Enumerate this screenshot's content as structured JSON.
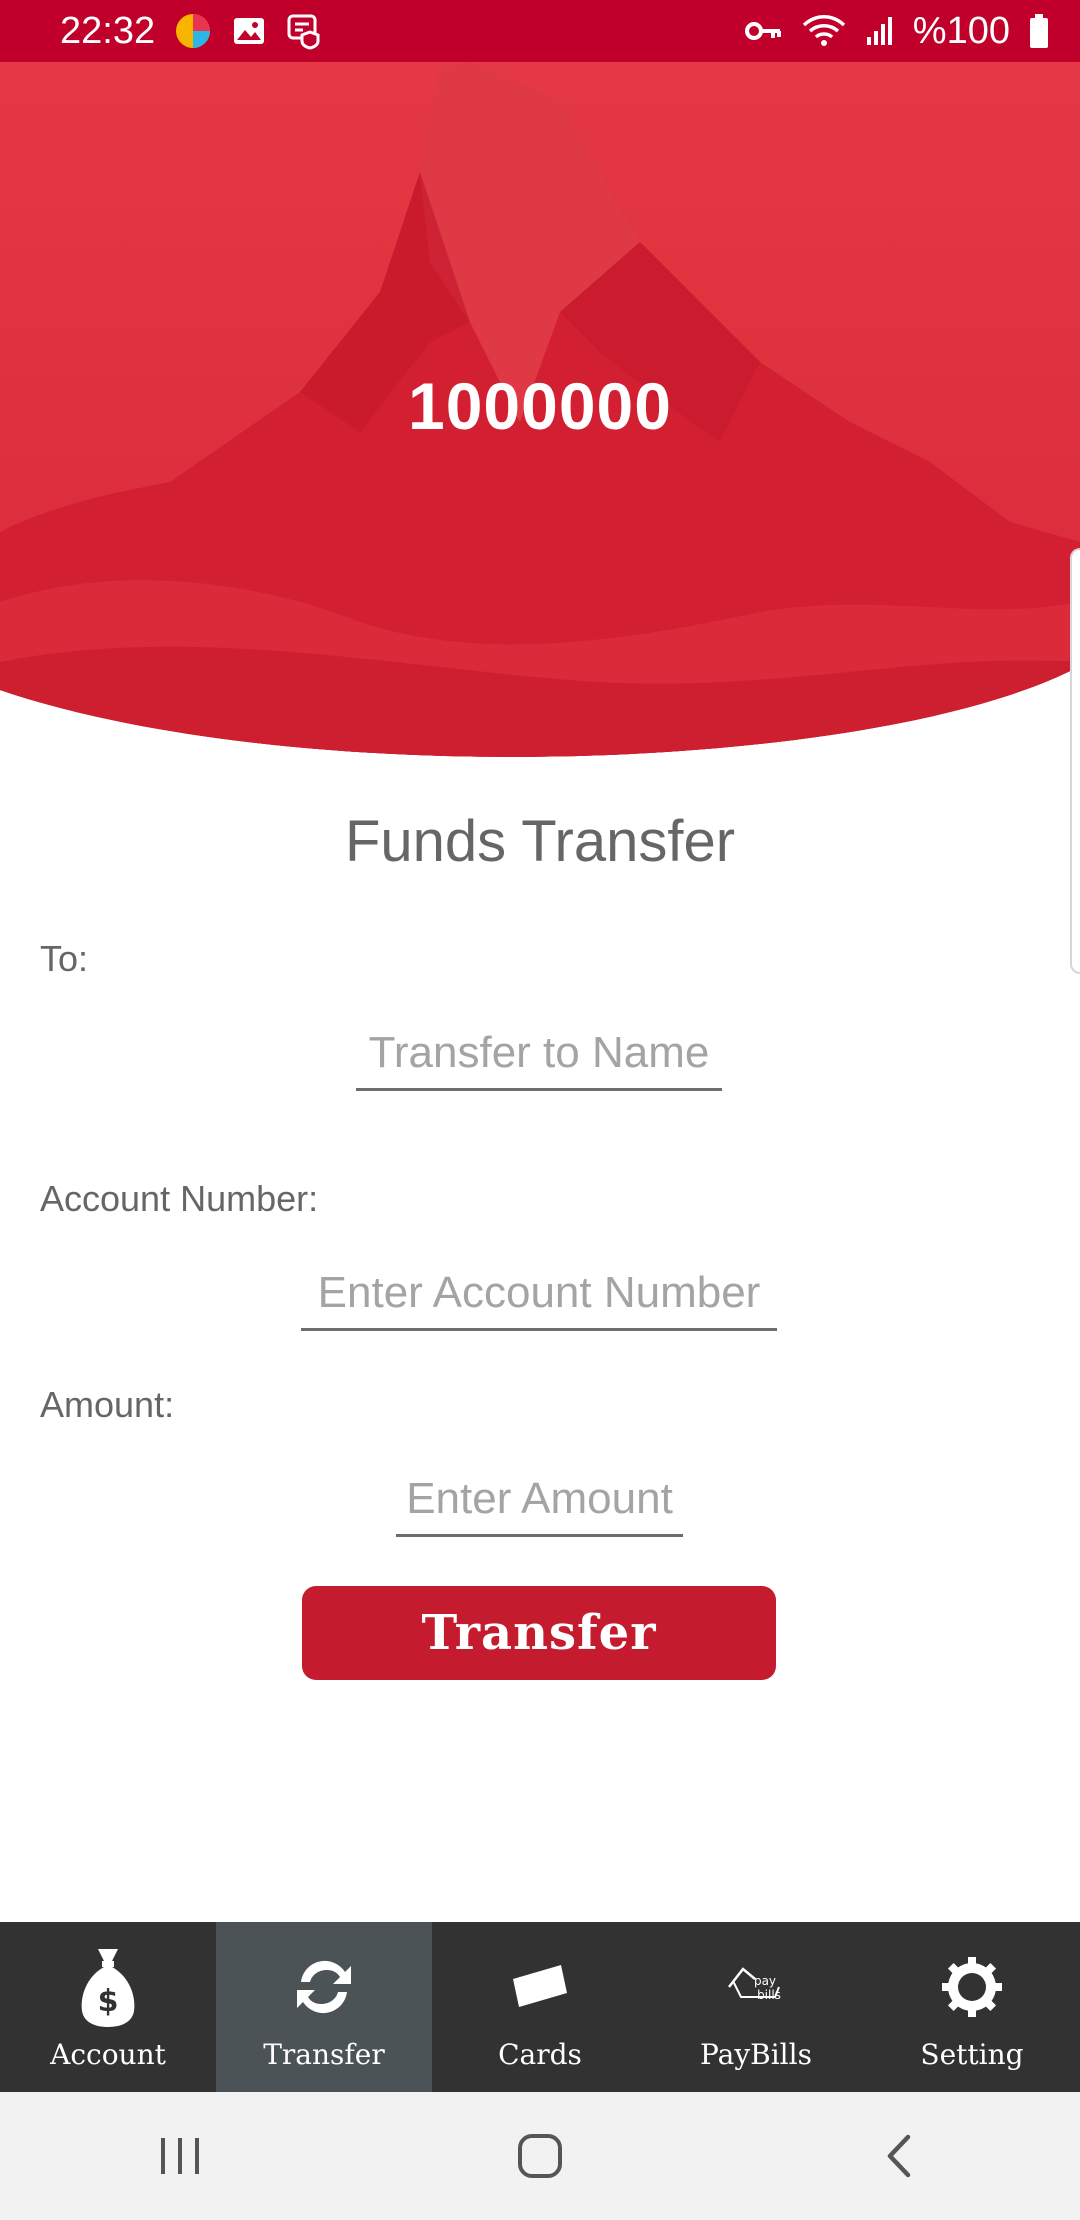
{
  "status_bar": {
    "time": "22:32",
    "battery": "%100",
    "icons": [
      "app-icon",
      "image-icon",
      "security-icon",
      "vpn-key-icon",
      "wifi-icon",
      "signal-icon",
      "battery-icon"
    ]
  },
  "hero": {
    "balance": "1000000"
  },
  "form": {
    "title": "Funds Transfer",
    "to_label": "To:",
    "to_placeholder": "Transfer to Name",
    "to_value": "",
    "account_label": "Account Number:",
    "account_placeholder": "Enter Account Number",
    "account_value": "",
    "amount_label": "Amount:",
    "amount_placeholder": "Enter Amount",
    "amount_value": "",
    "submit_label": "Transfer"
  },
  "bottom_nav": {
    "items": [
      {
        "label": "Account",
        "icon": "money-bag-icon",
        "active": false
      },
      {
        "label": "Transfer",
        "icon": "refresh-icon",
        "active": true
      },
      {
        "label": "Cards",
        "icon": "card-icon",
        "active": false
      },
      {
        "label": "PayBills",
        "icon": "paybills-icon",
        "active": false,
        "icon_text": "pay bills"
      },
      {
        "label": "Setting",
        "icon": "gear-icon",
        "active": false
      }
    ]
  },
  "colors": {
    "brand_red": "#c41b2e",
    "status_bar": "#c0002a",
    "nav_bg": "#323232",
    "nav_active": "#4b5356"
  }
}
